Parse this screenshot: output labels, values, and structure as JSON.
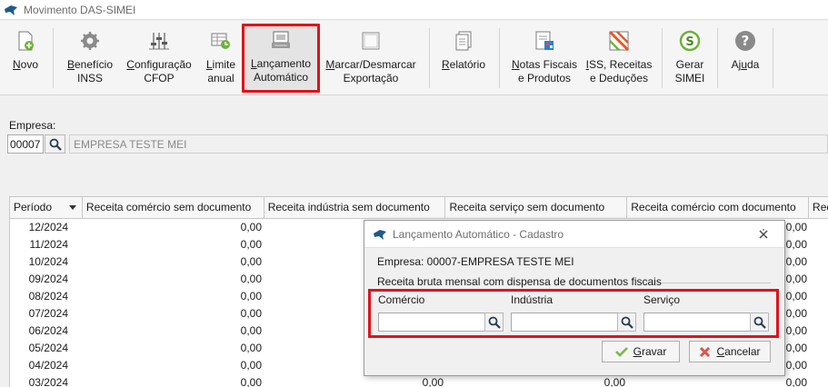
{
  "window": {
    "title": "Movimento DAS-SIMEI"
  },
  "toolbar": {
    "buttons": [
      {
        "id": "novo",
        "label_html": "<u>N</u>ovo",
        "icon": "new-document-icon"
      },
      {
        "id": "beneficio",
        "label_html": "<u>B</u>enefício\nINSS",
        "icon": "gear-icon"
      },
      {
        "id": "configuracao",
        "label_html": "<u>C</u>onfiguração\nCFOP",
        "icon": "config-sliders-icon"
      },
      {
        "id": "limite",
        "label_html": "<u>L</u>imite\nanual",
        "icon": "limit-table-icon"
      },
      {
        "id": "lancamento",
        "label_html": "<u>L</u>ançamento\nAutomático",
        "icon": "auto-posting-icon"
      },
      {
        "id": "marcar",
        "label_html": "<u>M</u>arcar/Desmarcar\nExportação",
        "icon": "checkbox-icon"
      },
      {
        "id": "relatorio",
        "label_html": "<u>R</u>elatório",
        "icon": "report-icon"
      },
      {
        "id": "notas",
        "label_html": "<u>N</u>otas Fiscais\ne Produtos",
        "icon": "invoice-icon"
      },
      {
        "id": "iss",
        "label_html": "<u>I</u>SS, Receitas\ne Deduções",
        "icon": "tax-icon"
      },
      {
        "id": "gerar",
        "label_html": "Gerar\nSIMEI",
        "icon": "generate-simei-icon"
      },
      {
        "id": "ajuda",
        "label_html": "Aj<u>u</u>da",
        "icon": "help-icon"
      }
    ]
  },
  "empresa": {
    "label": "Empresa:",
    "code": "00007",
    "name": "EMPRESA TESTE MEI"
  },
  "grid": {
    "columns": [
      "Período",
      "Receita comércio sem documento",
      "Receita indústria sem documento",
      "Receita serviço sem documento",
      "Receita comércio com documento",
      "Rec"
    ],
    "rows": [
      {
        "periodo": "12/2024",
        "c1": "0,00",
        "c2": "",
        "c3": "",
        "c4": "0,00"
      },
      {
        "periodo": "11/2024",
        "c1": "0,00",
        "c2": "",
        "c3": "",
        "c4": "0,00"
      },
      {
        "periodo": "10/2024",
        "c1": "0,00",
        "c2": "",
        "c3": "",
        "c4": "0,00"
      },
      {
        "periodo": "09/2024",
        "c1": "0,00",
        "c2": "",
        "c3": "",
        "c4": "0,00"
      },
      {
        "periodo": "08/2024",
        "c1": "0,00",
        "c2": "",
        "c3": "",
        "c4": "0,00"
      },
      {
        "periodo": "07/2024",
        "c1": "0,00",
        "c2": "",
        "c3": "",
        "c4": "0,00"
      },
      {
        "periodo": "06/2024",
        "c1": "0,00",
        "c2": "",
        "c3": "",
        "c4": "0,00"
      },
      {
        "periodo": "05/2024",
        "c1": "0,00",
        "c2": "",
        "c3": "",
        "c4": "0,00"
      },
      {
        "periodo": "04/2024",
        "c1": "0,00",
        "c2": "",
        "c3": "",
        "c4": "0,00"
      },
      {
        "periodo": "03/2024",
        "c1": "0,00",
        "c2": "0,00",
        "c3": "0,00",
        "c4": "0,00"
      }
    ]
  },
  "dialog": {
    "title": "Lançamento Automático - Cadastro",
    "empresa_text": "Empresa:   00007-EMPRESA TESTE MEI",
    "section": "Receita bruta mensal com dispensa de documentos fiscais",
    "fields": [
      {
        "label": "Comércio",
        "value": ""
      },
      {
        "label": "Indústria",
        "value": ""
      },
      {
        "label": "Serviço",
        "value": ""
      }
    ],
    "save_html": "<u>G</u>ravar",
    "cancel_html": "<u>C</u>ancelar"
  },
  "colors": {
    "highlight": "#e0121b",
    "ok_green": "#7ab648",
    "cancel_red": "#d9534f"
  }
}
